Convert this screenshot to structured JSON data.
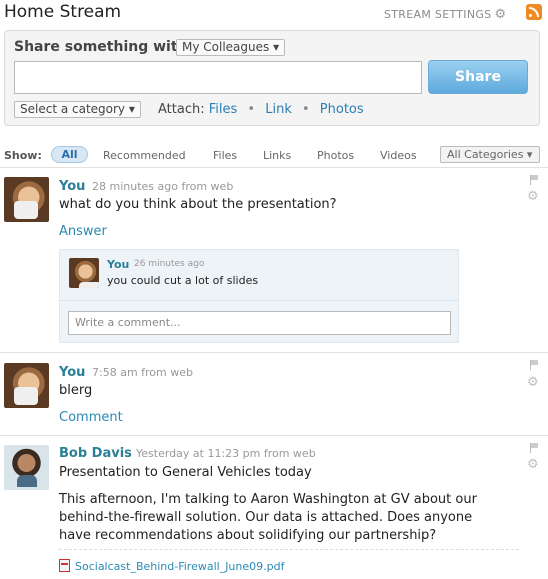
{
  "header": {
    "title": "Home Stream",
    "stream_settings_label": "STREAM SETTINGS",
    "icons": [
      "gear-icon",
      "rss-icon"
    ]
  },
  "share": {
    "label": "Share something with",
    "audience": "My Colleagues ▾",
    "input_value": "",
    "button": "Share",
    "category": "Select a category ▾",
    "attach_label": "Attach:",
    "attach_files": "Files",
    "attach_link": "Link",
    "attach_photos": "Photos"
  },
  "filters": {
    "show_label": "Show:",
    "tabs": [
      "All",
      "Recommended",
      "Files",
      "Links",
      "Photos",
      "Videos"
    ],
    "active": "All",
    "categories": "All Categories ▾"
  },
  "posts": [
    {
      "author": "You",
      "meta": "28 minutes ago from web",
      "text": "what do you think about the presentation?",
      "action": "Answer",
      "reply": {
        "author": "You",
        "meta": "26 minutes ago",
        "text": "you could cut a lot of slides",
        "comment_placeholder": "Write a comment..."
      }
    },
    {
      "author": "You",
      "meta": "7:58 am from web",
      "text": "blerg",
      "action": "Comment"
    },
    {
      "author": "Bob Davis",
      "meta": "Yesterday at 11:23 pm from web",
      "title": "Presentation to General Vehicles today",
      "body_lines": [
        "This afternoon, I'm talking to Aaron Washington at GV about our",
        "behind-the-firewall solution. Our data is attached. Does anyone",
        "have recommendations about solidifying our partnership?"
      ],
      "attachment": "Socialcast_Behind-Firewall_June09.pdf"
    }
  ]
}
